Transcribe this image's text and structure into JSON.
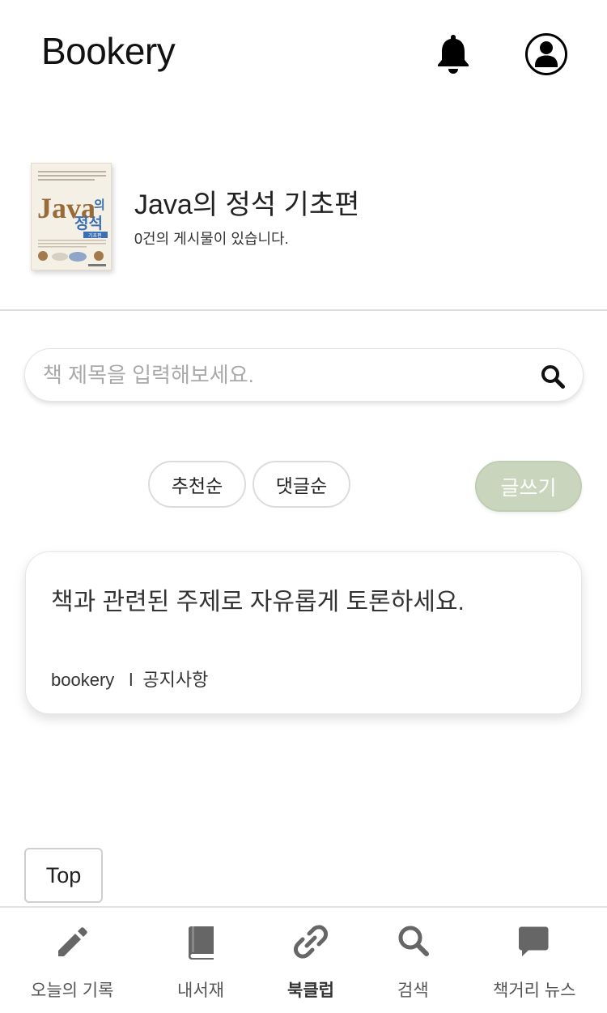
{
  "header": {
    "title": "Bookery"
  },
  "book": {
    "title": "Java의 정석 기초편",
    "post_count_text": "0건의 게시물이 있습니다.",
    "cover": {
      "title_en": "Java",
      "title_suffix": "의",
      "title_ko": "정석",
      "edition": "기초편"
    }
  },
  "search": {
    "placeholder": "책 제목을 입력해보세요."
  },
  "sort": {
    "recommend_label": "추천순",
    "comment_label": "댓글순"
  },
  "write_label": "글쓰기",
  "posts": [
    {
      "text": "책과 관련된 주제로 자유롭게 토론하세요.",
      "author": "bookery",
      "separator": "l",
      "category": "공지사항"
    }
  ],
  "top_label": "Top",
  "nav": {
    "items": [
      {
        "label": "오늘의 기록",
        "icon": "pencil-icon"
      },
      {
        "label": "내서재",
        "icon": "book-icon"
      },
      {
        "label": "북클럽",
        "icon": "link-icon",
        "active": true
      },
      {
        "label": "검색",
        "icon": "search-icon"
      },
      {
        "label": "책거리 뉴스",
        "icon": "chat-icon"
      }
    ]
  },
  "colors": {
    "write_button": "#c9d6bd",
    "accent_text": "#ffffff",
    "cover_title": "#9a6b3a",
    "cover_blue": "#3a6fb3"
  }
}
